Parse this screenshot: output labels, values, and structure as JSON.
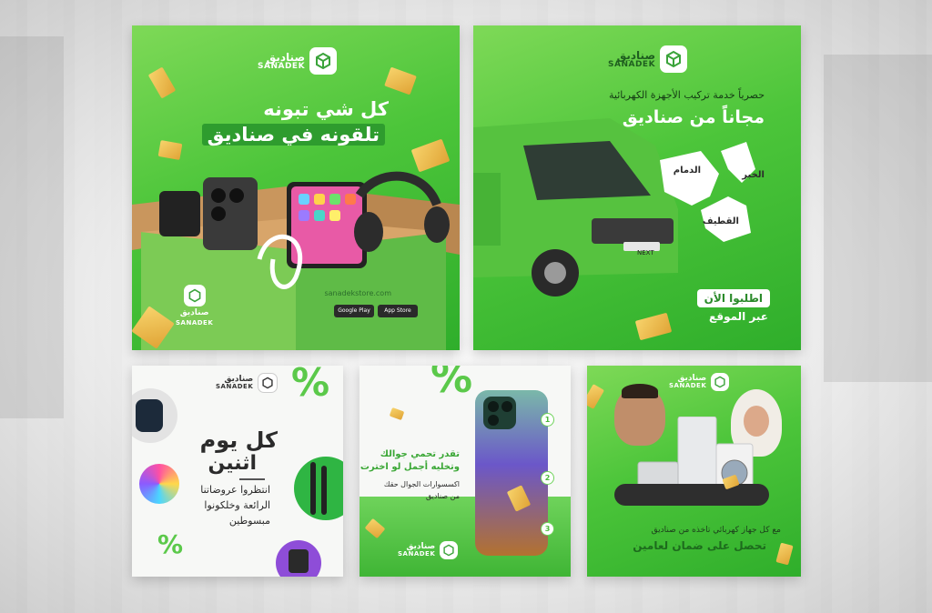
{
  "brand": {
    "name_ar": "صناديق",
    "name_en": "SANADEK"
  },
  "card1": {
    "line1": "كل شي تبونه",
    "line2": "تلقونه في صناديق",
    "box_url": "sanadekstore.com",
    "store_badges": [
      "Google Play",
      "App Store"
    ]
  },
  "card2": {
    "subtitle": "حصرياً خدمة تركيب الأجهزة الكهربائية",
    "title": "مجاناً من صناديق",
    "cities": [
      "الدمام",
      "الخبر",
      "القطيف"
    ],
    "cta": "اطلبوا الأن",
    "cta_sub": "عبر الموقع",
    "van_label": "NEXT"
  },
  "card3": {
    "title1": "كل يوم",
    "title2": "اثنين",
    "body": [
      "انتظروا عروضاتنا",
      "الرائعة وخلكونوا",
      "مبسوطين"
    ],
    "percent": "%"
  },
  "card4": {
    "title1": "تقدر تحمي جوالك",
    "title2": "وتخليه أجمل لو اخترت",
    "body1": "اكسسوارات الجوال حقك",
    "body2": "من صناديق",
    "steps": [
      "1",
      "2",
      "3"
    ],
    "percent": "%"
  },
  "card5": {
    "line1": "مع كل جهاز كهربائي تاخذه من صناديق",
    "line2": "تحصل على ضمان لعامين"
  },
  "colors": {
    "brand_green": "#4cc53a",
    "accent_gold": "#e9b84a"
  }
}
